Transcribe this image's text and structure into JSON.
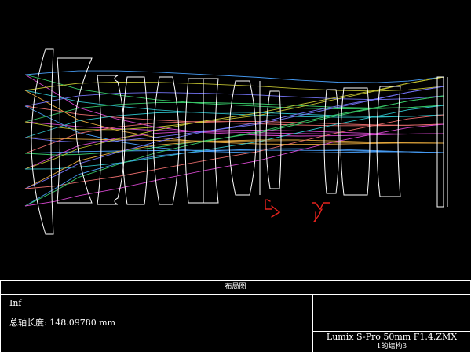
{
  "panel": {
    "title": "布局图",
    "field": "Inf",
    "axis_length_label": "总轴长度:",
    "axis_length_value": "148.09780 mm",
    "file_name": "Lumix S-Pro 50mm F1.4.ZMX",
    "configuration": "1的结构3"
  },
  "colors": {
    "background": "#000000",
    "lens_outline": "#ffffff",
    "annotation": "#e8231e",
    "rays": [
      "#4aa3ff",
      "#39d06c",
      "#e04ad8",
      "#c8c832",
      "#30c8d0",
      "#f0b040",
      "#7878ff",
      "#f07070"
    ]
  }
}
